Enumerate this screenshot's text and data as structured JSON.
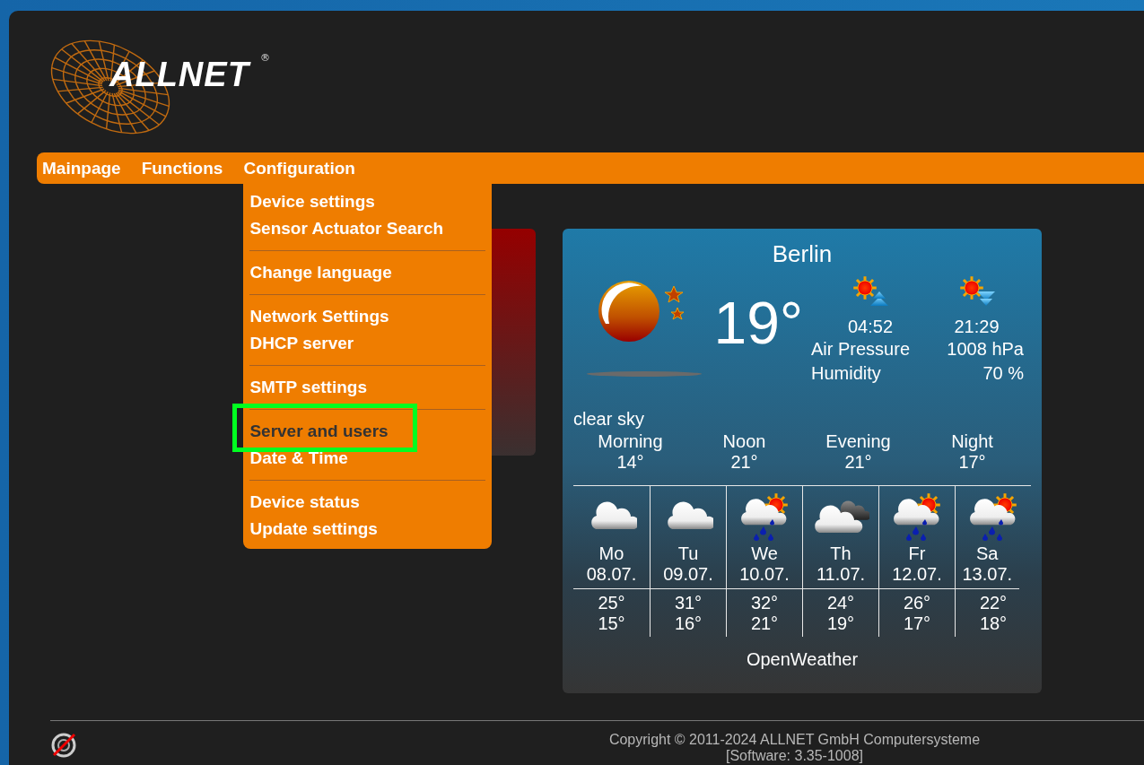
{
  "logo": {
    "name": "ALLNET",
    "mark": "®"
  },
  "nav": [
    {
      "label": "Mainpage"
    },
    {
      "label": "Functions"
    },
    {
      "label": "Configuration"
    }
  ],
  "menu": {
    "groups": [
      [
        {
          "label": "Device settings",
          "selected": false
        },
        {
          "label": "Sensor Actuator Search",
          "selected": false
        }
      ],
      [
        {
          "label": "Change language",
          "selected": false
        }
      ],
      [
        {
          "label": "Network Settings",
          "selected": false
        },
        {
          "label": "DHCP server",
          "selected": false
        }
      ],
      [
        {
          "label": "SMTP settings",
          "selected": false
        }
      ],
      [
        {
          "label": "Server and users",
          "selected": true
        },
        {
          "label": "Date & Time",
          "selected": false
        }
      ],
      [
        {
          "label": "Device status",
          "selected": false
        },
        {
          "label": "Update settings",
          "selected": false
        }
      ]
    ]
  },
  "weather": {
    "city": "Berlin",
    "temperature": "19°",
    "condition": "clear sky",
    "sunrise": "04:52",
    "sunset": "21:29",
    "details": [
      {
        "label": "Air Pressure",
        "value": "1008 hPa"
      },
      {
        "label": "Humidity",
        "value": "70 %"
      }
    ],
    "dayparts": [
      {
        "label": "Morning",
        "temp": "14°"
      },
      {
        "label": "Noon",
        "temp": "21°"
      },
      {
        "label": "Evening",
        "temp": "21°"
      },
      {
        "label": "Night",
        "temp": "17°"
      }
    ],
    "forecast": [
      {
        "kind": "cloud",
        "day": "Mo",
        "date": "08.07.",
        "high": "25°",
        "low": "15°"
      },
      {
        "kind": "cloud",
        "day": "Tu",
        "date": "09.07.",
        "high": "31°",
        "low": "16°"
      },
      {
        "kind": "rain-sun",
        "day": "We",
        "date": "10.07.",
        "high": "32°",
        "low": "21°"
      },
      {
        "kind": "cloud-dark",
        "day": "Th",
        "date": "11.07.",
        "high": "24°",
        "low": "19°"
      },
      {
        "kind": "rain-sun",
        "day": "Fr",
        "date": "12.07.",
        "high": "26°",
        "low": "17°"
      },
      {
        "kind": "rain-sun",
        "day": "Sa",
        "date": "13.07.",
        "high": "22°",
        "low": "18°"
      }
    ],
    "source": "OpenWeather"
  },
  "footer": {
    "copyright": "Copyright © 2011-2024 ALLNET GmbH Computersysteme",
    "software": "[Software: 3.35-1008]"
  }
}
